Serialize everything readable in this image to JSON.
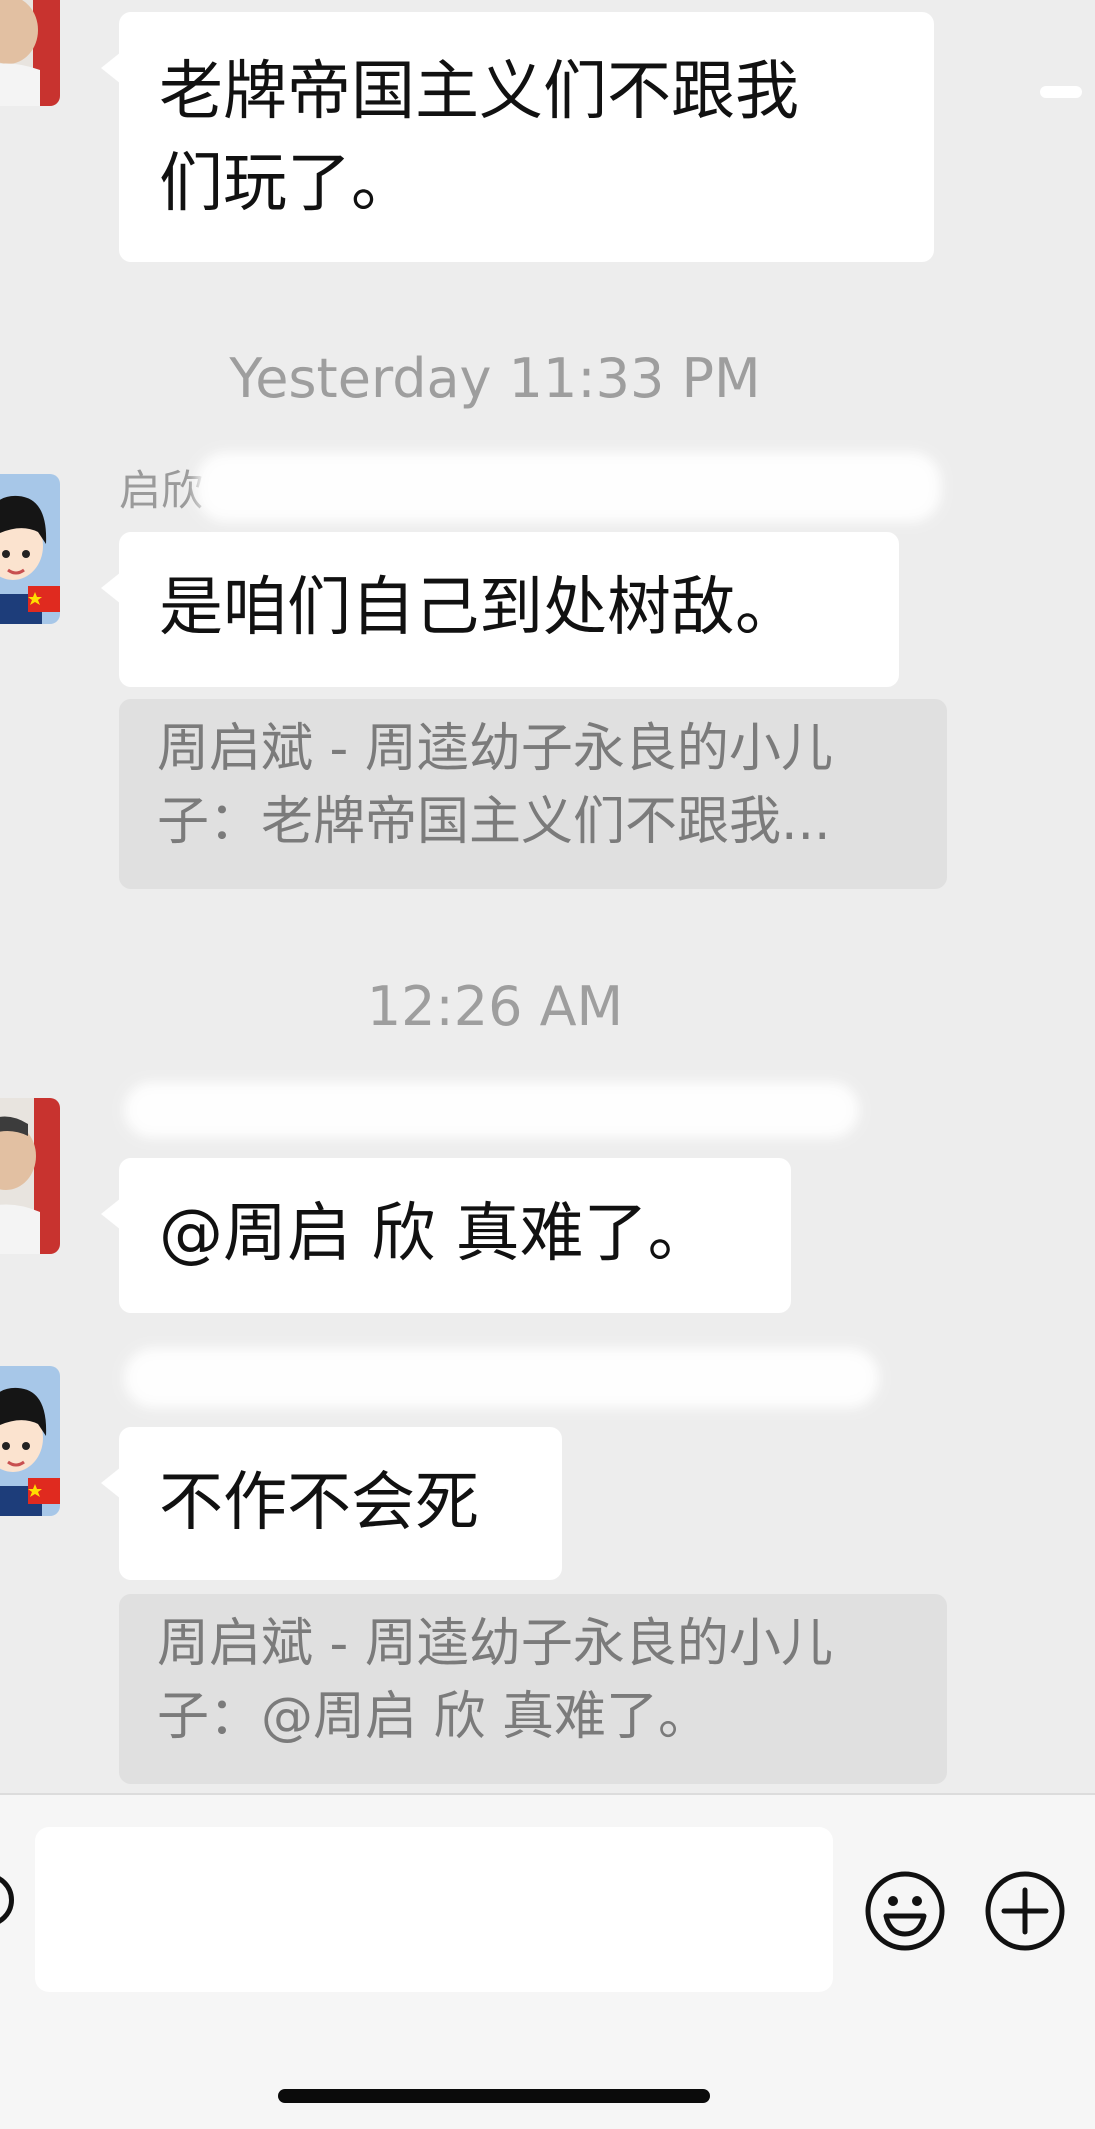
{
  "messages": [
    {
      "sender": "",
      "text": "老牌帝国主义们不跟我\n们玩了。"
    },
    {
      "sender": "启欣",
      "text": "是咱们自己到处树敌。"
    },
    {
      "sender": "",
      "text": "@周启 欣 真难了。"
    },
    {
      "sender": "",
      "text": "不作不会死"
    }
  ],
  "quotes": [
    {
      "text": "周启斌 - 周逵幼子永良的小儿子：老牌帝国主义们不跟我..."
    },
    {
      "text": "周启斌 - 周逵幼子永良的小儿子：@周启 欣 真难了。"
    }
  ],
  "timestamps": [
    "Yesterday 11:33 PM",
    "12:26 AM"
  ],
  "input": {
    "placeholder": ""
  },
  "icons": {
    "emoji": "emoji-icon",
    "plus": "plus-icon",
    "voice": "voice-icon"
  },
  "colors": {
    "background": "#ededed",
    "bubble": "#ffffff",
    "quote_bg": "#e0e0e0",
    "muted_text": "#9e9e9e"
  }
}
